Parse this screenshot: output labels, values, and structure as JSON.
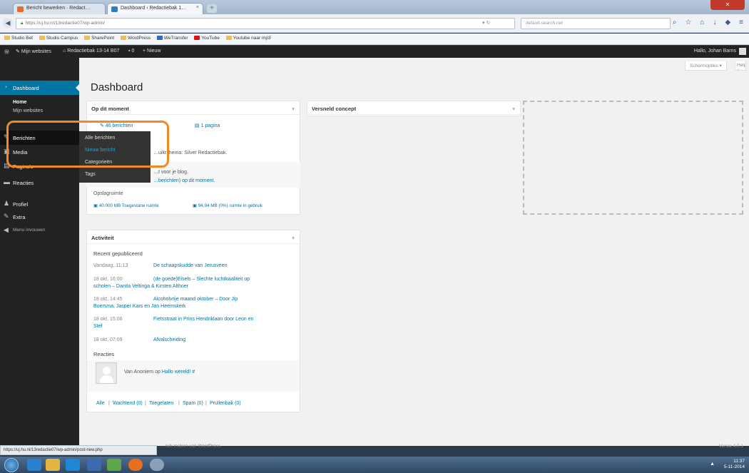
{
  "browser": {
    "tabs": [
      {
        "title": "Bericht bewerken · Redact…",
        "favicon_color": "#e26b2e"
      },
      {
        "title": "Dashboard ‹ Redactiebak 1…",
        "favicon_color": "#2e7dbd"
      }
    ],
    "new_tab": "+",
    "url": "https://uj.hu.nl/13redactie07/wp-admin/",
    "search_placeholder": "default-search.net",
    "nav_icons": [
      "search-icon",
      "star-icon",
      "home-icon",
      "download-icon",
      "shield-icon",
      "menu-icon"
    ],
    "bookmarks": [
      {
        "label": "Studio Bet",
        "icon": "folder"
      },
      {
        "label": "Studio Campus",
        "icon": "folder"
      },
      {
        "label": "SharePoint",
        "icon": "folder"
      },
      {
        "label": "WordPress",
        "icon": "folder"
      },
      {
        "label": "WeTransfer",
        "icon": "wt"
      },
      {
        "label": "YouTube",
        "icon": "yt"
      },
      {
        "label": "Youtube naar mp3",
        "icon": "folder"
      }
    ]
  },
  "adminbar": {
    "my_sites": "Mijn websites",
    "site_name": "Redactiebak 13-14 B07",
    "comments_count": "0",
    "new": "Nieuw",
    "greeting": "Hallo, Johan Barns"
  },
  "menu": {
    "dashboard": "Dashboard",
    "home": "Home",
    "my_sites": "Mijn websites",
    "posts": "Berichten",
    "media": "Media",
    "pages": "Pagina's",
    "comments": "Reacties",
    "profile": "Profiel",
    "extra": "Extra",
    "collapse": "Menu invouwen"
  },
  "flyout": {
    "all_posts": "Alle berichten",
    "new_post": "Nieuw bericht",
    "categories": "Categorieën",
    "tags": "Tags"
  },
  "page": {
    "title": "Dashboard",
    "screen_options": "Schermopties ▾",
    "help": "Help ▾"
  },
  "at_a_glance": {
    "title": "Op dit moment",
    "posts_count": "46 berichten",
    "pages_count": "1 pagina",
    "theme_text": "…uikt thema: Silver Redactiebak.",
    "search_text_1": "…t voor je blog.",
    "search_text_2": "…berichten) op dit moment.",
    "storage_title": "Opslagruimte",
    "storage_allowed": "40.000 MB Toegestane ruimte",
    "storage_used": "94,94 MB (0%) ruimte in gebruik"
  },
  "quick_draft": {
    "title": "Versneld concept"
  },
  "activity": {
    "title": "Activiteit",
    "recent_heading": "Recent gepubliceerd",
    "posts": [
      {
        "date": "Vandaag, 11:13",
        "title": "De schaapskudde van Jerusveen",
        "title2": ""
      },
      {
        "date": "18 okt, 16:00",
        "title": "(de goede)Eisels – Slechte luchtkwaliteit op",
        "title2": "scholen – Danita Veltinga & Kirsten Althoer"
      },
      {
        "date": "18 okt, 14:45",
        "title": "Alcoholvrije maand oktober – Door Jip",
        "title2": "Boersma, Jasper Kars en Jan Heemskerk"
      },
      {
        "date": "18 okt, 15:06",
        "title": "Fietsstraat in Prins Hendriklaan door Leon en",
        "title2": "Stef"
      },
      {
        "date": "18 okt, 07:09",
        "title": "Afvalscheiding",
        "title2": ""
      }
    ],
    "comments_heading": "Reacties",
    "comment_text": "Van Anoniem op",
    "comment_link": "Hallo wereld! #",
    "filters": [
      "Alle",
      "Wachtend (0)",
      "Toegelaten",
      "Spam (0)",
      "Prullenbak (0)"
    ]
  },
  "footer": {
    "credit": "…ruik maken van WordPress.",
    "version": "Versie 4.0.1"
  },
  "statusbar_url": "https://uj.hu.nl/13redactie07/wp-admin/post-new.php",
  "taskbar": {
    "apps": [
      "explorer",
      "windows-explorer",
      "security",
      "office",
      "paint",
      "firefox",
      "chrome"
    ],
    "time": "11:37",
    "date": "5-11-2014",
    "tray": "▲"
  },
  "colors": {
    "wp_blue": "#0074a2",
    "highlight_orange": "#f08a24",
    "admin_dark": "#222222"
  }
}
